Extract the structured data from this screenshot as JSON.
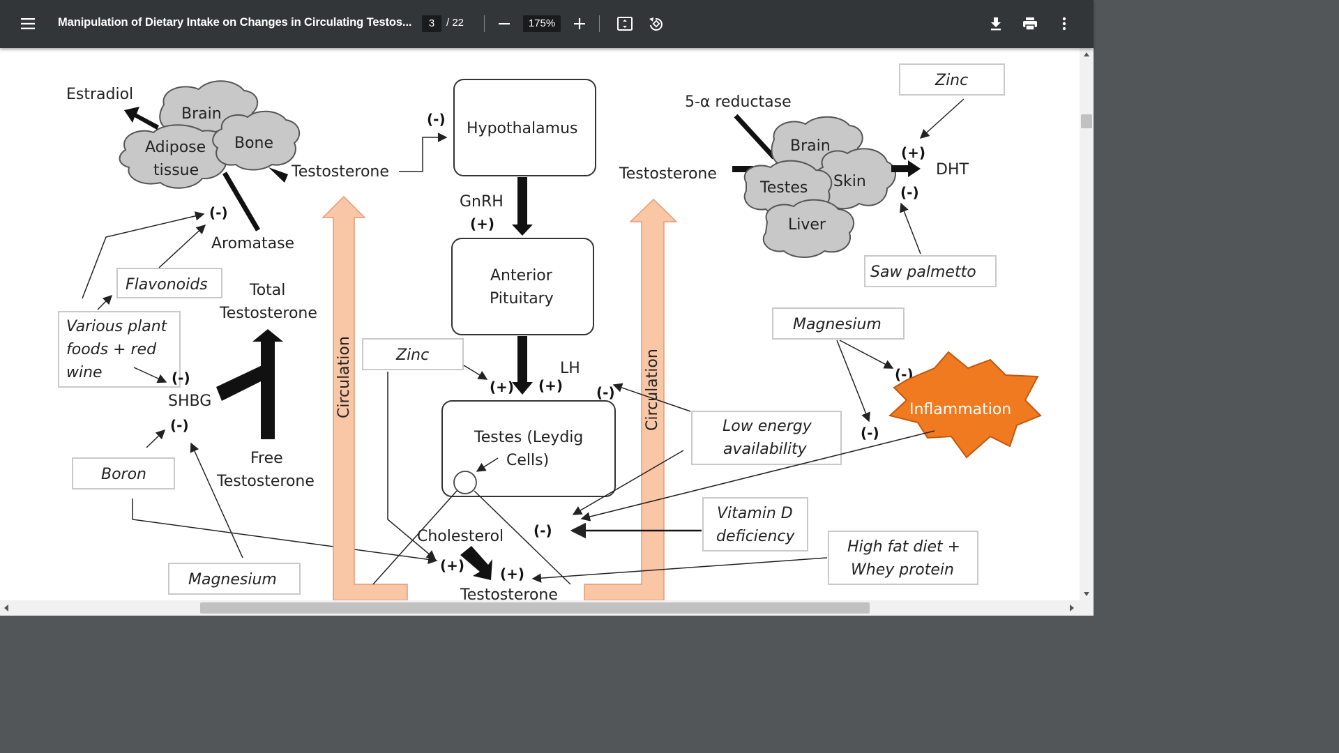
{
  "toolbar": {
    "title": "Manipulation of Dietary Intake on Changes in Circulating Testos...",
    "current_page": "3",
    "total_pages": "/ 22",
    "zoom": "175%"
  },
  "icons": [
    "menu-icon",
    "zoom-out-icon",
    "zoom-in-icon",
    "fit-page-icon",
    "rotate-icon",
    "download-icon",
    "print-icon",
    "more-options-icon"
  ],
  "diagram": {
    "estradiol": "Estradiol",
    "brain_left": "Brain",
    "adipose_1": "Adipose",
    "adipose_2": "tissue",
    "bone": "Bone",
    "testosterone_left": "Testosterone",
    "neg_top_left": "(-)",
    "neg_aromatase": "(-)",
    "aromatase": "Aromatase",
    "flavonoids": "Flavonoids",
    "total_1": "Total",
    "total_2": "Testosterone",
    "plant_1": "Various plant",
    "plant_2": "foods + red",
    "plant_3": "wine",
    "neg_shbg_top": "(-)",
    "shbg": "SHBG",
    "neg_shbg_bottom": "(-)",
    "boron": "Boron",
    "free_1": "Free",
    "free_2": "Testosterone",
    "magnesium_left": "Magnesium",
    "circulation_left": "Circulation",
    "hypothalamus": "Hypothalamus",
    "gnrh": "GnRH",
    "pos_gnrh": "(+)",
    "pituitary_1": "Anterior",
    "pituitary_2": "Pituitary",
    "zinc_mid": "Zinc",
    "pos_lh_left": "(+)",
    "pos_lh_right": "(+)",
    "lh": "LH",
    "neg_testes": "(-)",
    "testes_1": "Testes (Leydig",
    "testes_2": "Cells)",
    "cholesterol": "Cholesterol",
    "pos_chol": "(+)",
    "pos_testo": "(+)",
    "neg_vitd": "(-)",
    "testosterone_bottom": "Testosterone",
    "circulation_right": "Circulation",
    "testosterone_right": "Testosterone",
    "reductase": "5-α reductase",
    "brain_right": "Brain",
    "testes_cloud": "Testes",
    "skin": "Skin",
    "liver": "Liver",
    "dht": "DHT",
    "zinc_right": "Zinc",
    "pos_dht": "(+)",
    "neg_dht": "(-)",
    "saw_palmetto": "Saw palmetto",
    "magnesium_right": "Magnesium",
    "neg_inflam_top": "(-)",
    "neg_inflam_left": "(-)",
    "inflammation": "Inflammation",
    "low_energy_1": "Low energy",
    "low_energy_2": "availability",
    "vitd_1": "Vitamin D",
    "vitd_2": "deficiency",
    "hfd_1": "High fat diet +",
    "hfd_2": "Whey protein"
  },
  "colors": {
    "toolbar_bg": "#323639",
    "circulation_fill": "#f9c6a6",
    "inflammation_fill": "#f07a20",
    "cloud_fill": "#c8c8c8"
  }
}
